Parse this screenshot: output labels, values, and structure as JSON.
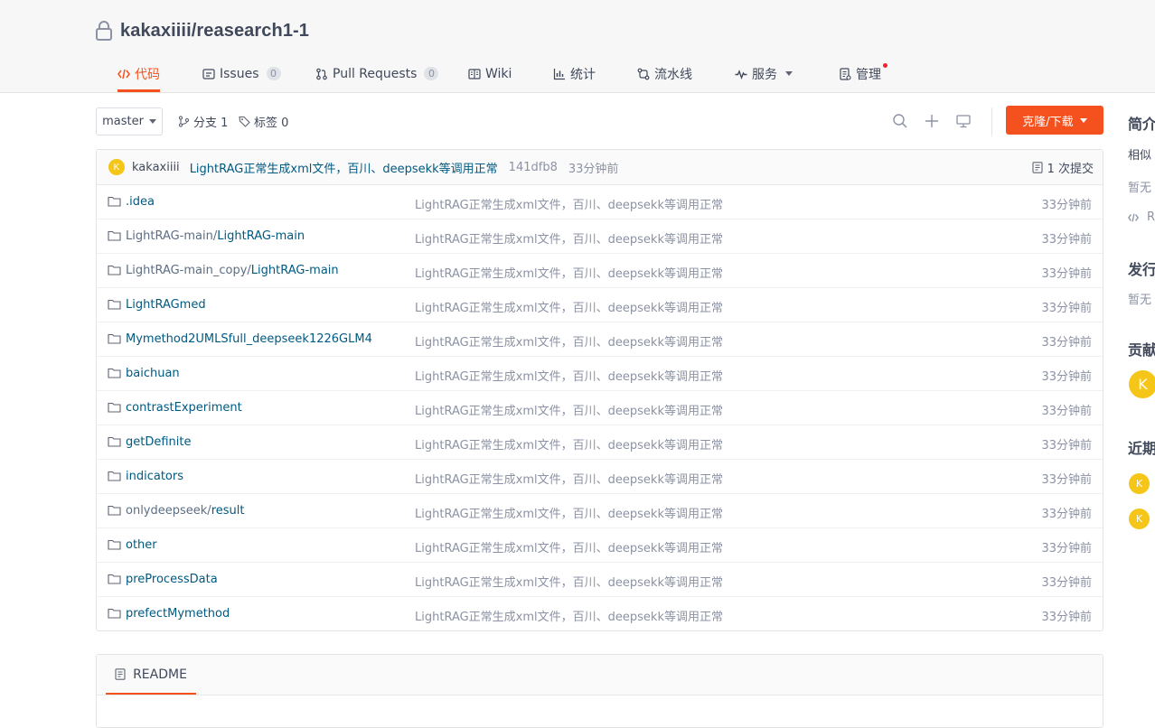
{
  "repo": {
    "full_name": "kakaxiiii/reasearch1-1"
  },
  "tabs": [
    {
      "label": "代码"
    },
    {
      "label": "Issues",
      "count": "0"
    },
    {
      "label": "Pull Requests",
      "count": "0"
    },
    {
      "label": "Wiki"
    },
    {
      "label": "统计"
    },
    {
      "label": "流水线"
    },
    {
      "label": "服务"
    },
    {
      "label": "管理"
    }
  ],
  "toolbar": {
    "branch": "master",
    "branches_label": "分支 1",
    "tags_label": "标签 0",
    "clone_label": "克隆/下载"
  },
  "last_commit": {
    "avatar_letter": "K",
    "author": "kakaxiiii",
    "message": "LightRAG正常生成xml文件，百川、deepsekk等调用正常",
    "sha": "141dfb8",
    "time": "33分钟前",
    "commits_label": "1 次提交"
  },
  "files": [
    {
      "prefix": "",
      "name": ".idea",
      "commit": "LightRAG正常生成xml文件，百川、deepsekk等调用正常",
      "time": "33分钟前"
    },
    {
      "prefix": "LightRAG-main/",
      "name": "LightRAG-main",
      "commit": "LightRAG正常生成xml文件，百川、deepsekk等调用正常",
      "time": "33分钟前"
    },
    {
      "prefix": "LightRAG-main_copy/",
      "name": "LightRAG-main",
      "commit": "LightRAG正常生成xml文件，百川、deepsekk等调用正常",
      "time": "33分钟前"
    },
    {
      "prefix": "",
      "name": "LightRAGmed",
      "commit": "LightRAG正常生成xml文件，百川、deepsekk等调用正常",
      "time": "33分钟前"
    },
    {
      "prefix": "",
      "name": "Mymethod2UMLSfull_deepseek1226GLM4",
      "commit": "LightRAG正常生成xml文件，百川、deepsekk等调用正常",
      "time": "33分钟前"
    },
    {
      "prefix": "",
      "name": "baichuan",
      "commit": "LightRAG正常生成xml文件，百川、deepsekk等调用正常",
      "time": "33分钟前"
    },
    {
      "prefix": "",
      "name": "contrastExperiment",
      "commit": "LightRAG正常生成xml文件，百川、deepsekk等调用正常",
      "time": "33分钟前"
    },
    {
      "prefix": "",
      "name": "getDefinite",
      "commit": "LightRAG正常生成xml文件，百川、deepsekk等调用正常",
      "time": "33分钟前"
    },
    {
      "prefix": "",
      "name": "indicators",
      "commit": "LightRAG正常生成xml文件，百川、deepsekk等调用正常",
      "time": "33分钟前"
    },
    {
      "prefix": "onlydeepseek/",
      "name": "result",
      "commit": "LightRAG正常生成xml文件，百川、deepsekk等调用正常",
      "time": "33分钟前"
    },
    {
      "prefix": "",
      "name": "other",
      "commit": "LightRAG正常生成xml文件，百川、deepsekk等调用正常",
      "time": "33分钟前"
    },
    {
      "prefix": "",
      "name": "preProcessData",
      "commit": "LightRAG正常生成xml文件，百川、deepsekk等调用正常",
      "time": "33分钟前"
    },
    {
      "prefix": "",
      "name": "prefectMymethod",
      "commit": "LightRAG正常生成xml文件，百川、deepsekk等调用正常",
      "time": "33分钟前"
    }
  ],
  "readme": {
    "tab_label": "README"
  },
  "sidebar": {
    "intro_heading": "简介",
    "intro_text": "相似",
    "intro_empty": "暂无",
    "code_link": "R",
    "release_heading": "发行",
    "release_empty": "暂无",
    "contrib_heading": "贡献",
    "contrib_avatar": "K",
    "recent_heading": "近期",
    "recent_avatars": [
      "K",
      "K"
    ]
  },
  "colors": {
    "accent": "#f4511e",
    "link": "#005980",
    "avatar": "#f5c518"
  }
}
